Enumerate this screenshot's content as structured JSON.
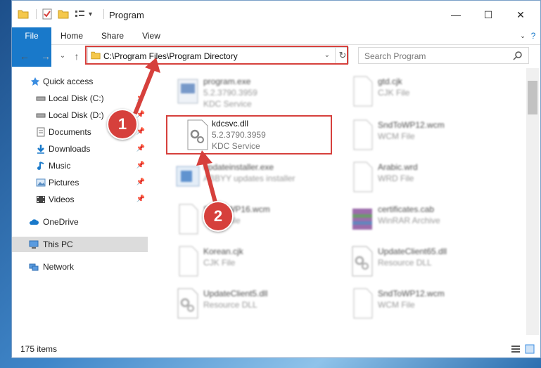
{
  "titlebar": {
    "title": "Program",
    "buttons": {
      "minimize": "—",
      "maximize": "☐",
      "close": "✕"
    }
  },
  "ribbon": {
    "tabs": [
      "File",
      "Home",
      "Share",
      "View"
    ],
    "help": "?"
  },
  "address_bar": {
    "back": "←",
    "forward": "→",
    "recent": "⌄",
    "up": "↑",
    "path": "C:\\Program Files\\Program Directory",
    "dropdown": "⌄",
    "refresh": "↻"
  },
  "search": {
    "placeholder": "Search Program"
  },
  "nav": {
    "quick_access": "Quick access",
    "items": [
      {
        "label": "Local Disk (C:)",
        "pin": "📌"
      },
      {
        "label": "Local Disk (D:)",
        "pin": "📌"
      },
      {
        "label": "Documents",
        "pin": "📌"
      },
      {
        "label": "Downloads",
        "pin": "📌"
      },
      {
        "label": "Music",
        "pin": "📌"
      },
      {
        "label": "Pictures",
        "pin": "📌"
      },
      {
        "label": "Videos",
        "pin": "📌"
      }
    ],
    "onedrive": "OneDrive",
    "this_pc": "This PC",
    "network": "Network"
  },
  "files": [
    {
      "name": "program.exe",
      "line1": "5.2.3790.3959",
      "line2": "KDC Service"
    },
    {
      "name": "gtd.cjk",
      "line1": "CJK File",
      "line2": ""
    },
    {
      "name": "kdcsvc.dll",
      "line1": "5.2.3790.3959",
      "line2": "KDC Service"
    },
    {
      "name": "SndToWP12.wcm",
      "line1": "WCM File",
      "line2": ""
    },
    {
      "name": "updateinstaller.exe",
      "line1": "ABBYY updates installer",
      "line2": ""
    },
    {
      "name": "Arabic.wrd",
      "line1": "WRD File",
      "line2": ""
    },
    {
      "name": "SndToWP16.wcm",
      "line1": "WCM File",
      "line2": ""
    },
    {
      "name": "certificates.cab",
      "line1": "WinRAR Archive",
      "line2": ""
    },
    {
      "name": "Korean.cjk",
      "line1": "CJK File",
      "line2": ""
    },
    {
      "name": "UpdateClient65.dll",
      "line1": "Resource DLL",
      "line2": ""
    },
    {
      "name": "UpdateClient5.dll",
      "line1": "Resource DLL",
      "line2": ""
    },
    {
      "name": "SndToWP12.wcm",
      "line1": "WCM File",
      "line2": ""
    }
  ],
  "status": {
    "count": "175 items"
  },
  "callouts": {
    "one": "1",
    "two": "2"
  },
  "colors": {
    "accent": "#1979ca",
    "highlight": "#d6403c"
  }
}
